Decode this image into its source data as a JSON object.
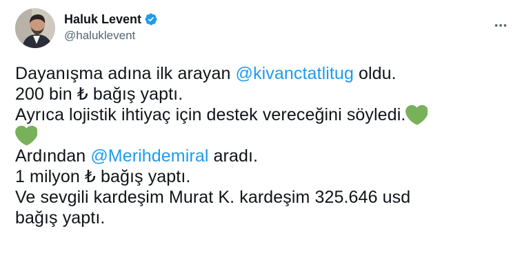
{
  "author": {
    "display_name": "Haluk Levent",
    "handle": "@haluklevent",
    "verified": true,
    "avatar_icon": "avatar-photo"
  },
  "more_icon": "ellipsis-icon",
  "tweet": {
    "line1_a": "Dayanışma adına ilk arayan ",
    "line1_mention": "@kivanctatlitug",
    "line1_b": " oldu.",
    "line2": "200 bin ₺ bağış yaptı.",
    "line3": "Ayrıca lojistik ihtiyaç için destek vereceğini söyledi.",
    "line3_emoji": "green-heart-icon",
    "line4_emoji": "green-heart-icon",
    "line5_a": "Ardından ",
    "line5_mention": "@Merihdemiral",
    "line5_b": " aradı.",
    "line6": "1 milyon ₺ bağış yaptı.",
    "line7": "Ve sevgili kardeşim Murat K. kardeşim 325.646 usd",
    "line8": "bağış yaptı."
  },
  "colors": {
    "mention": "#1d9bf0",
    "verified_badge": "#1d9bf0",
    "heart": "#78b159",
    "text": "#0f1419",
    "secondary_text": "#536471"
  }
}
